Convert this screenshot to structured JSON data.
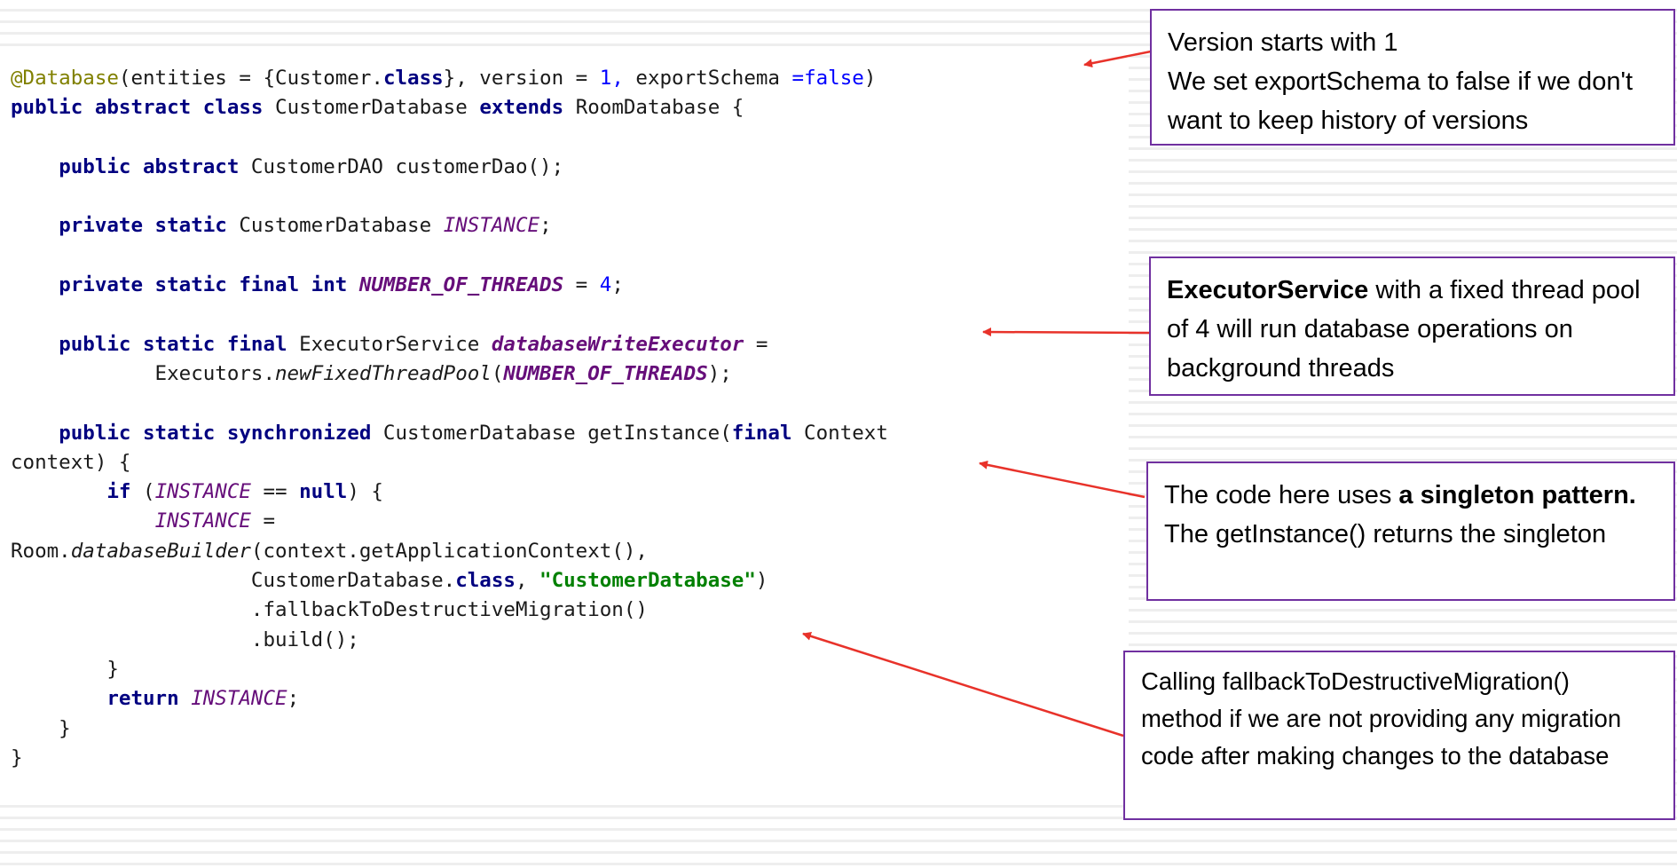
{
  "code": [
    [
      {
        "t": "@Database",
        "c": "anno"
      },
      {
        "t": "(entities = {Customer."
      },
      {
        "t": "class",
        "c": "kw"
      },
      {
        "t": "}, version = "
      },
      {
        "t": "1,",
        "c": "num"
      },
      {
        "t": " exportSchema "
      },
      {
        "t": "=false",
        "c": "num"
      },
      {
        "t": ")"
      }
    ],
    [
      {
        "t": "public abstract class",
        "c": "kw"
      },
      {
        "t": " CustomerDatabase "
      },
      {
        "t": "extends",
        "c": "kw"
      },
      {
        "t": " RoomDatabase {"
      }
    ],
    [],
    [
      {
        "t": "    "
      },
      {
        "t": "public abstract",
        "c": "kw"
      },
      {
        "t": " CustomerDAO customerDao();"
      }
    ],
    [],
    [
      {
        "t": "    "
      },
      {
        "t": "private static",
        "c": "kw"
      },
      {
        "t": " CustomerDatabase "
      },
      {
        "t": "INSTANCE",
        "c": "fld"
      },
      {
        "t": ";"
      }
    ],
    [],
    [
      {
        "t": "    "
      },
      {
        "t": "private static final int",
        "c": "kw"
      },
      {
        "t": " "
      },
      {
        "t": "NUMBER_OF_THREADS",
        "c": "fldb"
      },
      {
        "t": " = "
      },
      {
        "t": "4",
        "c": "num"
      },
      {
        "t": ";"
      }
    ],
    [],
    [
      {
        "t": "    "
      },
      {
        "t": "public static final",
        "c": "kw"
      },
      {
        "t": " ExecutorService "
      },
      {
        "t": "databaseWriteExecutor",
        "c": "fldb"
      },
      {
        "t": " ="
      }
    ],
    [
      {
        "t": "            Executors."
      },
      {
        "t": "newFixedThreadPool",
        "c": "mth"
      },
      {
        "t": "("
      },
      {
        "t": "NUMBER_OF_THREADS",
        "c": "fldb"
      },
      {
        "t": ");"
      }
    ],
    [],
    [
      {
        "t": "    "
      },
      {
        "t": "public static synchronized",
        "c": "kw"
      },
      {
        "t": " CustomerDatabase getInstance("
      },
      {
        "t": "final",
        "c": "kw"
      },
      {
        "t": " Context"
      }
    ],
    [
      {
        "t": "context) {"
      }
    ],
    [
      {
        "t": "        "
      },
      {
        "t": "if",
        "c": "kw"
      },
      {
        "t": " ("
      },
      {
        "t": "INSTANCE",
        "c": "fld"
      },
      {
        "t": " == "
      },
      {
        "t": "null",
        "c": "kw"
      },
      {
        "t": ") {"
      }
    ],
    [
      {
        "t": "            "
      },
      {
        "t": "INSTANCE",
        "c": "fld"
      },
      {
        "t": " ="
      }
    ],
    [
      {
        "t": "Room."
      },
      {
        "t": "databaseBuilder",
        "c": "mth"
      },
      {
        "t": "(context.getApplicationContext(),"
      }
    ],
    [
      {
        "t": "                    CustomerDatabase."
      },
      {
        "t": "class",
        "c": "kw"
      },
      {
        "t": ", "
      },
      {
        "t": "\"CustomerDatabase\"",
        "c": "str"
      },
      {
        "t": ")"
      }
    ],
    [
      {
        "t": "                    .fallbackToDestructiveMigration()"
      }
    ],
    [
      {
        "t": "                    .build();"
      }
    ],
    [
      {
        "t": "        }"
      }
    ],
    [
      {
        "t": "        "
      },
      {
        "t": "return",
        "c": "kw"
      },
      {
        "t": " "
      },
      {
        "t": "INSTANCE",
        "c": "fld"
      },
      {
        "t": ";"
      }
    ],
    [
      {
        "t": "    }"
      }
    ],
    [
      {
        "t": "}"
      }
    ]
  ],
  "callouts": {
    "version": {
      "line1": "Version starts with 1",
      "line2": "We set exportSchema to false if we don't want to keep history of versions"
    },
    "executor": {
      "bold": "ExecutorService",
      "text": " with a fixed thread pool of 4 will run database operations on background threads"
    },
    "singleton": {
      "pre": "The code here uses ",
      "bold": "a singleton pattern.",
      "post": " The getInstance() returns the singleton"
    },
    "fallback": {
      "text": "Calling fallbackToDestructiveMigration() method if we are not providing any migration code after making changes to the database"
    }
  },
  "colors": {
    "keyword": "#000080",
    "annotation": "#808000",
    "number": "#0000ff",
    "field": "#660e7a",
    "string": "#008000",
    "callout_border": "#7030a0",
    "arrow": "#e8322a"
  }
}
